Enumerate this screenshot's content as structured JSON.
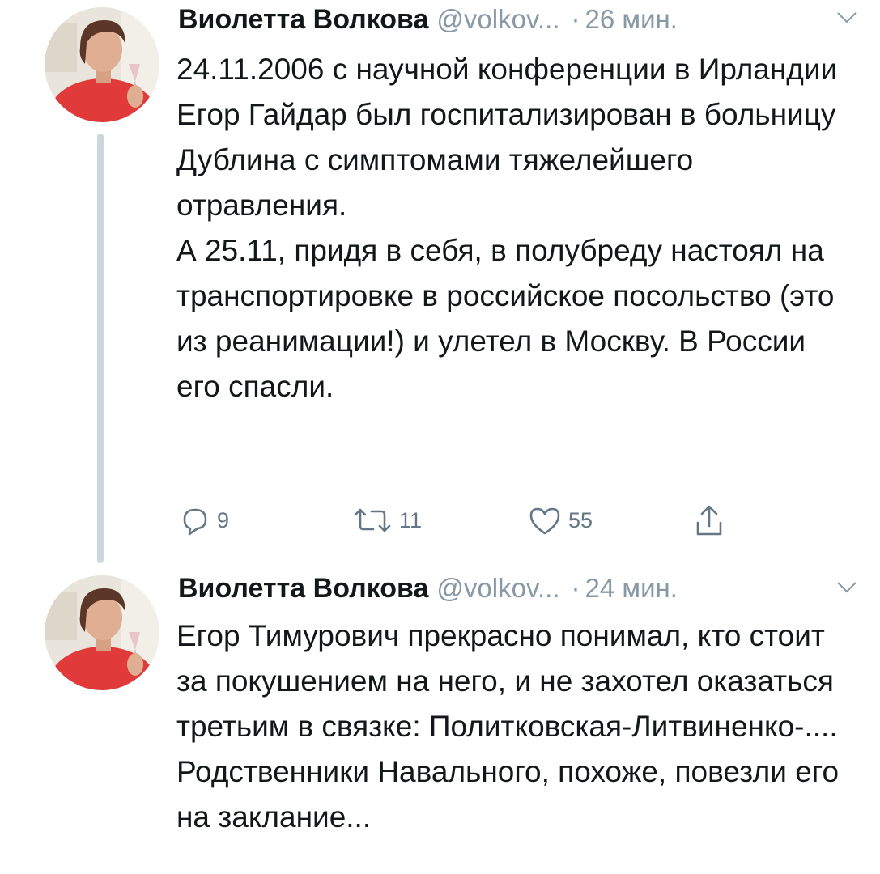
{
  "thread": [
    {
      "author": {
        "name": "Виолетта Волкова",
        "handle": "@volkov...",
        "avatar": "avatar-photo"
      },
      "separator": "·",
      "time": "26 мин.",
      "paragraphs": [
        "24.11.2006 с научной конференции в Ирландии Егор Гайдар был госпитализирован в больницу Дублина с симптомами тяжелейшего отравления.",
        "А 25.11, придя в себя, в полубреду настоял на транспортировке в российское посольство (это из реанимации!) и улетел в Москву. В России его спасли."
      ],
      "actions": {
        "reply": {
          "icon": "reply-icon",
          "count": "9"
        },
        "retweet": {
          "icon": "retweet-icon",
          "count": "11"
        },
        "like": {
          "icon": "heart-icon",
          "count": "55"
        },
        "share": {
          "icon": "share-icon"
        }
      }
    },
    {
      "author": {
        "name": "Виолетта Волкова",
        "handle": "@volkov...",
        "avatar": "avatar-photo"
      },
      "separator": "·",
      "time": "24 мин.",
      "paragraphs": [
        "Егор Тимурович прекрасно понимал, кто стоит за покушением на него, и не захотел оказаться третьим в связке: Политковская-Литвиненко-.... Родственники Навального, похоже, повезли его на заклание..."
      ]
    }
  ],
  "colors": {
    "text": "#14171a",
    "secondary": "#8899a6",
    "icon": "#657786",
    "thread_line": "#ccd6dd"
  }
}
